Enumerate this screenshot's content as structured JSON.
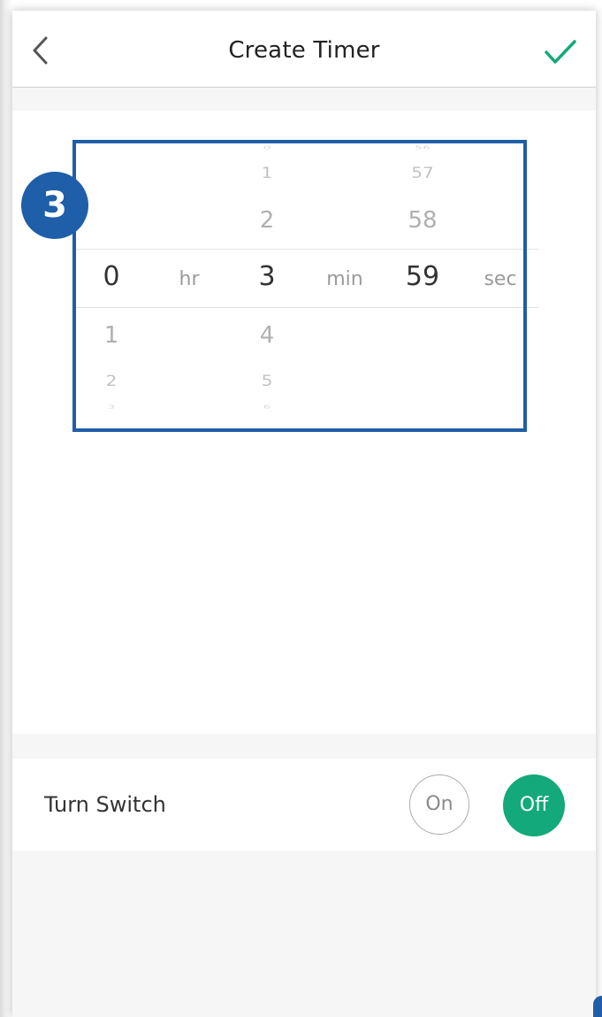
{
  "navbar": {
    "title": "Create Timer",
    "back_icon": "chevron-left-icon",
    "confirm_icon": "checkmark-icon",
    "accent_color": "#13a97a"
  },
  "picker": {
    "hours": {
      "above": [
        "",
        "",
        "",
        ""
      ],
      "selected": "0",
      "below": [
        "1",
        "2",
        "3"
      ],
      "unit": "hr"
    },
    "minutes": {
      "above": [
        "0",
        "1",
        "2"
      ],
      "selected": "3",
      "below": [
        "4",
        "5",
        "6"
      ],
      "unit": "min"
    },
    "seconds": {
      "above": [
        "56",
        "57",
        "58"
      ],
      "selected": "59",
      "below": [
        "",
        "",
        ""
      ],
      "unit": "sec"
    }
  },
  "annotation": {
    "step_number": "3",
    "color": "#1f5ea8"
  },
  "switch_row": {
    "label": "Turn Switch",
    "on_label": "On",
    "off_label": "Off",
    "selected": "Off"
  }
}
